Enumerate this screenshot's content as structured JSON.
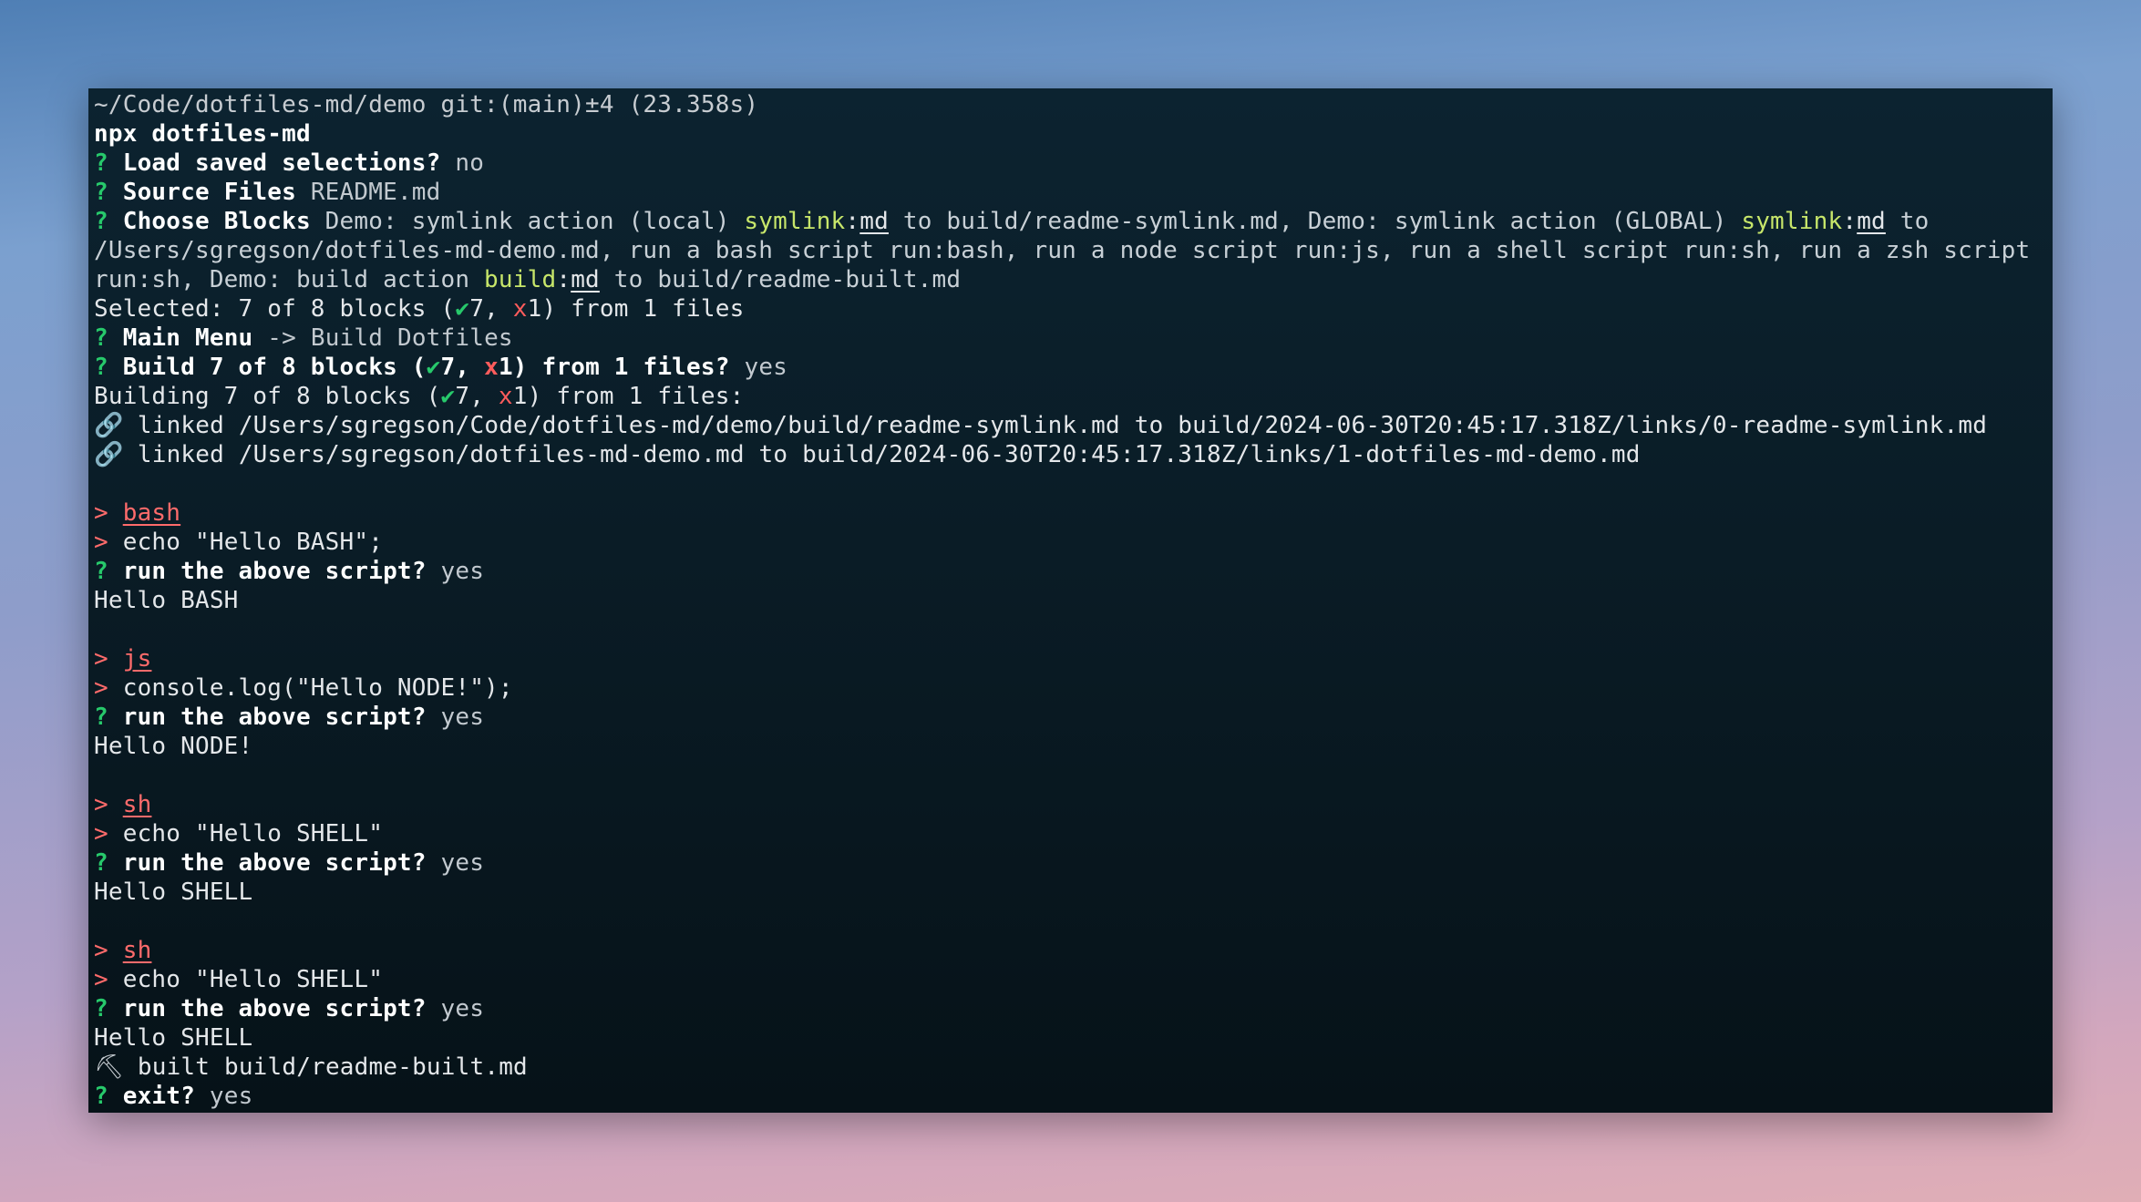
{
  "prompt_line": "~/Code/dotfiles-md/demo git:(main)±4 (23.358s)",
  "command": "npx dotfiles-md",
  "q_mark": "?",
  "prompt_gt": ">",
  "load_saved": {
    "question": "Load saved selections?",
    "answer": "no"
  },
  "source_files": {
    "question": "Source Files",
    "answer": "README.md"
  },
  "choose_blocks": {
    "question": "Choose Blocks",
    "seg1": "Demo: symlink action (local) ",
    "seg1_tag": "symlink",
    "colon": ":",
    "seg1_type": "md",
    "seg1_rest": " to build/readme-symlink.md, Demo: symlink action (GLOBAL) ",
    "seg2_tag": "symlink",
    "seg2_type": "md",
    "seg2_rest": " to",
    "line2": "/Users/sgregson/dotfiles-md-demo.md, run a bash script run:bash, run a node script run:js, run a shell script run:sh, run a zsh script",
    "line3_a": "run:sh, Demo: build action ",
    "line3_tag": "build",
    "line3_type": "md",
    "line3_rest": " to build/readme-built.md"
  },
  "selected": {
    "prefix": "Selected: 7 of 8 blocks (",
    "check": "✔",
    "check_count": "7",
    "sep": ", ",
    "x": "x",
    "x_count": "1",
    "suffix": ") from 1 files"
  },
  "main_menu": {
    "question": "Main Menu",
    "arrow": "->",
    "answer": "Build Dotfiles"
  },
  "build_confirm": {
    "prefix": "Build 7 of 8 blocks (",
    "check": "✔",
    "check_count": "7",
    "sep": ", ",
    "x": "x",
    "x_count": "1",
    "suffix": ") from 1 files?",
    "answer": "yes"
  },
  "building": {
    "prefix": "Building 7 of 8 blocks (",
    "check": "✔",
    "check_count": "7",
    "sep": ", ",
    "x": "x",
    "x_count": "1",
    "suffix": ") from 1 files:"
  },
  "links": [
    {
      "icon": "link-icon",
      "glyph": "🔗",
      "text": "linked /Users/sgregson/Code/dotfiles-md/demo/build/readme-symlink.md to build/2024-06-30T20:45:17.318Z/links/0-readme-symlink.md"
    },
    {
      "icon": "link-icon",
      "glyph": "🔗",
      "text": "linked /Users/sgregson/dotfiles-md-demo.md to build/2024-06-30T20:45:17.318Z/links/1-dotfiles-md-demo.md"
    }
  ],
  "scripts": [
    {
      "lang": "bash",
      "code": "echo \"Hello BASH\";",
      "question": "run the above script?",
      "answer": "yes",
      "output": "Hello BASH"
    },
    {
      "lang": "js",
      "code": "console.log(\"Hello NODE!\");",
      "question": "run the above script?",
      "answer": "yes",
      "output": "Hello NODE!"
    },
    {
      "lang": "sh",
      "code": "echo \"Hello SHELL\"",
      "question": "run the above script?",
      "answer": "yes",
      "output": "Hello SHELL"
    },
    {
      "lang": "sh",
      "code": "echo \"Hello SHELL\"",
      "question": "run the above script?",
      "answer": "yes",
      "output": "Hello SHELL"
    }
  ],
  "built": {
    "icon": "hammer-icon",
    "glyph": "⛏",
    "text": "built build/readme-built.md"
  },
  "exit": {
    "question": "exit?",
    "answer": "yes"
  }
}
